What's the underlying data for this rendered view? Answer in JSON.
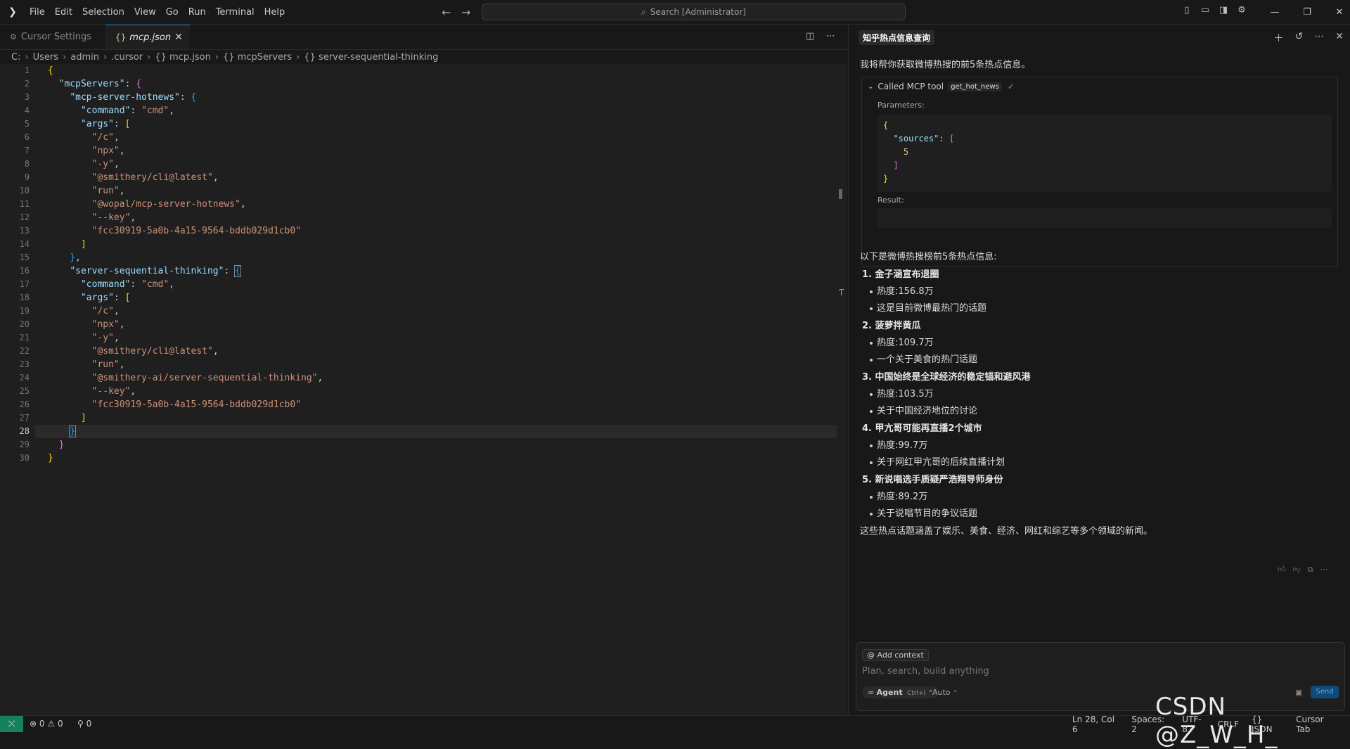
{
  "menu": [
    "File",
    "Edit",
    "Selection",
    "View",
    "Go",
    "Run",
    "Terminal",
    "Help"
  ],
  "search_placeholder": "Search [Administrator]",
  "tabs": {
    "settings": "Cursor Settings",
    "active": "mcp.json"
  },
  "breadcrumb": [
    "C:",
    "Users",
    "admin",
    ".cursor",
    "{} mcp.json",
    "{} mcpServers",
    "{} server-sequential-thinking"
  ],
  "editor": {
    "current_line": 28,
    "line_numbers": [
      "1",
      "2",
      "3",
      "4",
      "5",
      "6",
      "7",
      "8",
      "9",
      "10",
      "11",
      "12",
      "13",
      "14",
      "15",
      "16",
      "17",
      "18",
      "19",
      "20",
      "21",
      "22",
      "23",
      "24",
      "25",
      "26",
      "27",
      "28",
      "29",
      "30"
    ]
  },
  "chat": {
    "title": "知乎热点信息查询",
    "intro": "我将帮你获取微博热搜的前5条热点信息。",
    "tool_call": {
      "label": "Called MCP tool",
      "name": "get_hot_news",
      "params_label": "Parameters:",
      "result_label": "Result:"
    },
    "answer_lead": "以下是微博热搜榜前5条热点信息:",
    "items": [
      {
        "title": "1. 金子涵宣布退圈",
        "heat": "热度:156.8万",
        "desc": "这是目前微博最热门的话题"
      },
      {
        "title": "2. 菠萝拌黄瓜",
        "heat": "热度:109.7万",
        "desc": "一个关于美食的热门话题"
      },
      {
        "title": "3. 中国始终是全球经济的稳定锚和避风港",
        "heat": "热度:103.5万",
        "desc": "关于中国经济地位的讨论"
      },
      {
        "title": "4. 甲亢哥可能再直播2个城市",
        "heat": "热度:99.7万",
        "desc": "关于网红甲亢哥的后续直播计划"
      },
      {
        "title": "5. 新说唱选手质疑严浩翔导师身份",
        "heat": "热度:89.2万",
        "desc": "关于说唱节目的争议话题"
      }
    ],
    "summary": "这些热点话题涵盖了娱乐、美食、经济、网红和综艺等多个领域的新闻。",
    "input": {
      "add_context": "Add context",
      "placeholder": "Plan, search, build anything",
      "agent": "Agent",
      "agent_shortcut": "Ctrl+I",
      "auto": "Auto",
      "send": "Send"
    }
  },
  "status": {
    "errors": "0",
    "warnings": "0",
    "ports": "0",
    "position": "Ln 28, Col 6",
    "spaces": "Spaces: 2",
    "encoding": "UTF-8",
    "eol": "CRLF",
    "language": "{} JSON",
    "cursor_tab": "Cursor Tab"
  },
  "watermark": "CSDN @Z_W_H_",
  "colors": {
    "accent": "#0078d4",
    "remote": "#16825d",
    "check": "#3fb950"
  }
}
